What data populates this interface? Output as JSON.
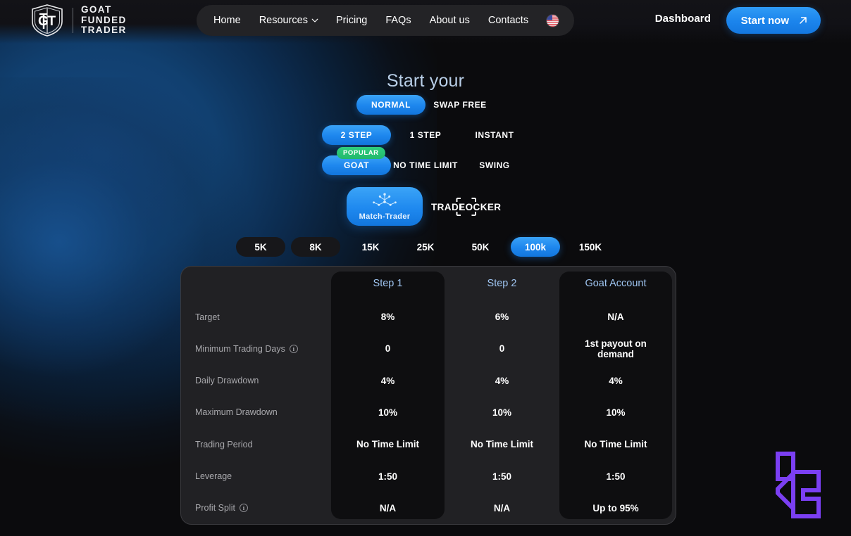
{
  "header": {
    "logo": {
      "icon": "gft-shield-logo-icon",
      "text": "GOAT\nFUNDED\nTRADER"
    },
    "nav": [
      {
        "label": "Home",
        "has_chevron": false
      },
      {
        "label": "Resources",
        "has_chevron": true
      },
      {
        "label": "Pricing",
        "has_chevron": false
      },
      {
        "label": "FAQs",
        "has_chevron": false
      },
      {
        "label": "About us",
        "has_chevron": false
      },
      {
        "label": "Contacts",
        "has_chevron": false
      }
    ],
    "language_flag": "us-flag-icon",
    "dashboard_label": "Dashboard",
    "start_now_label": "Start now",
    "start_now_icon": "arrow-up-right-icon",
    "accent_color": "#1e87ee"
  },
  "hero": {
    "title": "Start your",
    "title_color": "#b9cfe8"
  },
  "selectors": {
    "account_type": {
      "options": [
        "NORMAL",
        "SWAP FREE"
      ],
      "selected": "NORMAL"
    },
    "challenge_steps": {
      "options": [
        "2 STEP",
        "1 STEP",
        "INSTANT"
      ],
      "selected": "2 STEP"
    },
    "plan": {
      "options": [
        "GOAT",
        "NO TIME LIMIT",
        "SWING"
      ],
      "selected": "GOAT",
      "badge": "POPULAR",
      "badge_color": "#22b86c"
    },
    "platform": {
      "options": [
        "Match-Trader",
        "TRADELOCKER"
      ],
      "selected": "Match-Trader"
    },
    "account_size": {
      "options": [
        "5K",
        "8K",
        "15K",
        "25K",
        "50K",
        "100k",
        "150K"
      ],
      "selected": "100k"
    }
  },
  "comparison_table": {
    "columns": [
      "",
      "Step 1",
      "Step 2",
      "Goat Account"
    ],
    "highlighted_columns": [
      "Step 1",
      "Goat Account"
    ],
    "header_color": "#9ec4f0",
    "rows": [
      {
        "label": "Target",
        "info": false,
        "values": [
          "8%",
          "6%",
          "N/A"
        ]
      },
      {
        "label": "Minimum Trading Days",
        "info": true,
        "values": [
          "0",
          "0",
          "1st payout on demand"
        ]
      },
      {
        "label": "Daily Drawdown",
        "info": false,
        "values": [
          "4%",
          "4%",
          "4%"
        ]
      },
      {
        "label": "Maximum Drawdown",
        "info": false,
        "values": [
          "10%",
          "10%",
          "10%"
        ]
      },
      {
        "label": "Trading Period",
        "info": false,
        "values": [
          "No Time Limit",
          "No Time Limit",
          "No Time Limit"
        ]
      },
      {
        "label": "Leverage",
        "info": false,
        "values": [
          "1:50",
          "1:50",
          "1:50"
        ]
      },
      {
        "label": "Profit Split",
        "info": true,
        "values": [
          "N/A",
          "N/A",
          "Up to 95%"
        ]
      }
    ]
  },
  "watermark": {
    "icon": "purple-l-logo-icon",
    "color": "#7b3ff2"
  }
}
